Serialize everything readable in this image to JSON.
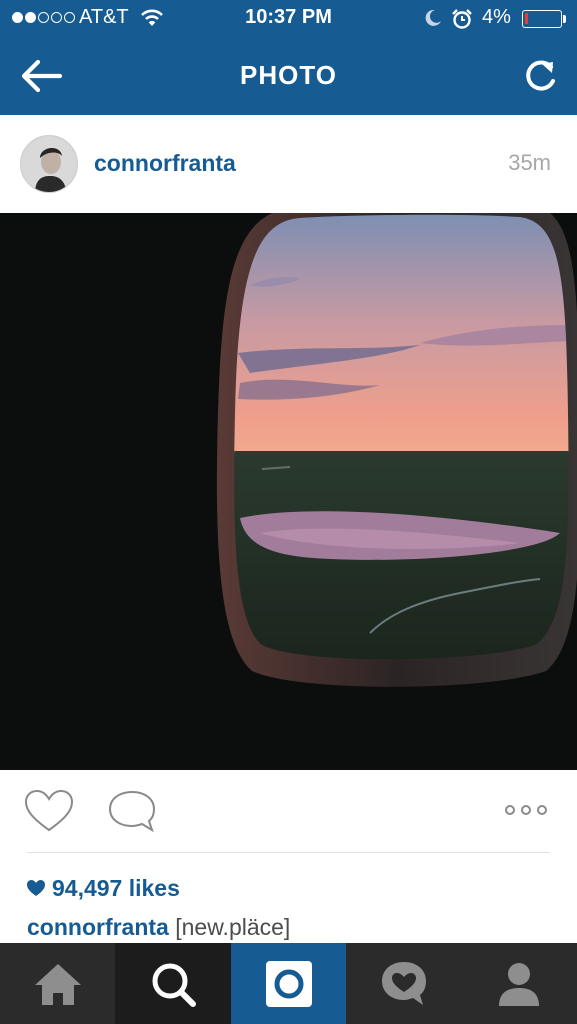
{
  "status_bar": {
    "signal_filled": 2,
    "signal_total": 5,
    "carrier": "AT&T",
    "time": "10:37 PM",
    "battery_percent": "4%",
    "battery_level": 0.04,
    "icons": [
      "wifi-icon",
      "moon-icon",
      "alarm-icon",
      "battery-icon"
    ]
  },
  "header": {
    "title": "PHOTO",
    "back_icon": "arrow-left-icon",
    "refresh_icon": "refresh-icon",
    "background": "#175b93"
  },
  "post": {
    "username": "connorfranta",
    "time_ago": "35m",
    "photo_subject": "sunset-through-airplane-window",
    "likes": "94,497 likes",
    "caption_user": "connorfranta",
    "caption_text": "[new.pläce]"
  },
  "actions": {
    "icons": [
      "heart-outline-icon",
      "comment-icon",
      "more-dots-icon"
    ]
  },
  "tab_bar": {
    "tabs": [
      {
        "name": "home",
        "icon": "home-icon"
      },
      {
        "name": "explore",
        "icon": "search-icon"
      },
      {
        "name": "camera",
        "icon": "camera-icon",
        "active": true
      },
      {
        "name": "activity",
        "icon": "activity-heart-icon"
      },
      {
        "name": "profile",
        "icon": "profile-icon"
      }
    ]
  },
  "colors": {
    "brand_blue": "#175b93",
    "tab_bar": "#2b2b2b",
    "muted_text": "#a7a7a7"
  }
}
